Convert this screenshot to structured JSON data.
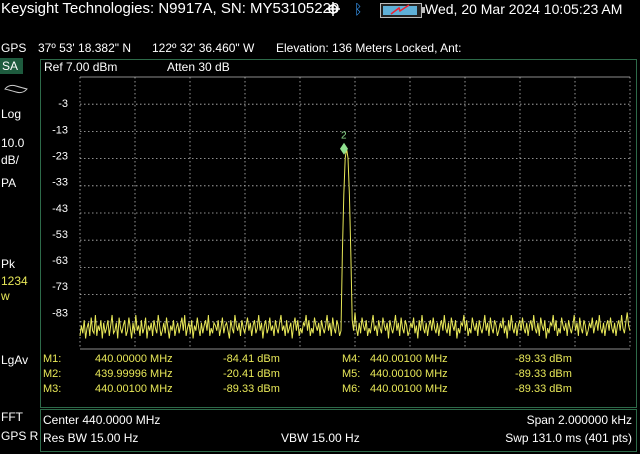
{
  "header": {
    "title": "Keysight Technologies: N9917A, SN: MY53105220",
    "datetime": "Wed, 20 Mar 2024 10:05:23 AM",
    "icons": [
      "gps-crosshair-icon",
      "bluetooth-icon",
      "battery-icon"
    ]
  },
  "gps": {
    "label": "GPS",
    "latitude": "37º 53' 18.382\" N",
    "longitude": "122º 32' 36.460\" W",
    "status": "Elevation: 136 Meters  Locked, Ant:"
  },
  "left_panel": {
    "mode": "SA",
    "scale_type": "Log",
    "scale_value": "10.0",
    "scale_unit": "dB/",
    "detector": "PA",
    "trace_label": "Pk",
    "trace_numbers": "1234",
    "trace_mode": "w",
    "average": "LgAv",
    "fft": "FFT",
    "gps_r": "GPS R"
  },
  "graph_header": {
    "ref_level": "Ref 7.00 dBm",
    "attenuation": "Atten 30 dB"
  },
  "chart_data": {
    "type": "line",
    "ylim": [
      -97,
      7
    ],
    "y_ticks": [
      "-3",
      "-13",
      "-23",
      "-33",
      "-43",
      "-53",
      "-63",
      "-73",
      "-83"
    ],
    "xlim_mhz": [
      439.999,
      440.001
    ],
    "colors": {
      "trace": "#e8e858",
      "grid": "#bdbdbd",
      "marker": "#8fe08f"
    },
    "peak_marker": {
      "label": "2",
      "x_mhz": 439.99996,
      "y_dbm": -20.41
    },
    "series": [
      {
        "values": [
          -92,
          -88,
          -91,
          -86,
          -93,
          -89,
          -87,
          -92,
          -85,
          -90,
          -91,
          -84,
          -92,
          -88,
          -90,
          -86,
          -93,
          -87,
          -91,
          -89,
          -86,
          -92,
          -88,
          -84,
          -91,
          -90,
          -87,
          -93,
          -85,
          -89,
          -91,
          -88,
          -86,
          -92,
          -90,
          -85,
          -89,
          -93,
          -87,
          -91,
          -84,
          -90,
          -88,
          -92,
          -86,
          -91,
          -89,
          -85,
          -93,
          -88,
          -90,
          -87,
          -92,
          -86,
          -89,
          -91,
          -84,
          -88,
          -92,
          -90,
          -87,
          -91,
          -85,
          -89,
          -93,
          -88,
          -90,
          -86,
          -92,
          -89,
          -87,
          -91,
          -88,
          -85,
          -90,
          -84,
          -92,
          -89,
          -87,
          -91,
          -86,
          -93,
          -88,
          -90,
          -85,
          -89,
          -92,
          -87,
          -91,
          -88,
          -86,
          -90,
          -84,
          -92,
          -89,
          -91,
          -87,
          -88,
          -90,
          -86,
          -92,
          -89,
          -85,
          -91,
          -88,
          -87,
          -90,
          -93,
          -86,
          -89,
          -91,
          -84,
          -88,
          -90,
          -87,
          -92,
          -86,
          -89,
          -91,
          -88,
          -85,
          -90,
          -87,
          -92,
          -88,
          -86,
          -91,
          -89,
          -84,
          -90,
          -87,
          -93,
          -88,
          -86,
          -91,
          -89,
          -85,
          -90,
          -88,
          -92,
          -86,
          -89,
          -91,
          -87,
          -84,
          -90,
          -88,
          -92,
          -86,
          -91,
          -89,
          -87,
          -93,
          -88,
          -85,
          -90,
          -86,
          -92,
          -89,
          -91,
          -87,
          -88,
          -84,
          -90,
          -86,
          -92,
          -89,
          -91,
          -85,
          -88,
          -90,
          -87,
          -92,
          -86,
          -89,
          -91,
          -88,
          -84,
          -90,
          -87,
          -92,
          -85,
          -89,
          -91,
          -86,
          -88,
          -92,
          -90,
          -60,
          -38,
          -24,
          -20.41,
          -24,
          -38,
          -60,
          -86,
          -90,
          -83,
          -89,
          -92,
          -87,
          -91,
          -85,
          -88,
          -90,
          -86,
          -92,
          -89,
          -91,
          -87,
          -84,
          -90,
          -88,
          -92,
          -86,
          -89,
          -91,
          -85,
          -88,
          -90,
          -87,
          -93,
          -86,
          -89,
          -91,
          -88,
          -84,
          -90,
          -87,
          -92,
          -85,
          -89,
          -91,
          -86,
          -88,
          -92,
          -90,
          -87,
          -89,
          -85,
          -91,
          -88,
          -93,
          -86,
          -90,
          -84,
          -89,
          -91,
          -87,
          -92,
          -88,
          -86,
          -90,
          -85,
          -89,
          -91,
          -87,
          -92,
          -88,
          -86,
          -90,
          -84,
          -89,
          -91,
          -87,
          -92,
          -85,
          -88,
          -90,
          -86,
          -93,
          -89,
          -91,
          -87,
          -88,
          -84,
          -90,
          -86,
          -92,
          -89,
          -91,
          -85,
          -88,
          -90,
          -87,
          -92,
          -86,
          -89,
          -91,
          -88,
          -84,
          -90,
          -87,
          -92,
          -85,
          -89,
          -91,
          -86,
          -88,
          -92,
          -90,
          -87,
          -89,
          -85,
          -91,
          -88,
          -93,
          -86,
          -90,
          -84,
          -89,
          -91,
          -87,
          -92,
          -88,
          -86,
          -90,
          -85,
          -89,
          -91,
          -87,
          -92,
          -88,
          -86,
          -90,
          -84,
          -89,
          -91,
          -87,
          -92,
          -85,
          -88,
          -90,
          -86,
          -93,
          -89,
          -91,
          -87,
          -88,
          -84,
          -90,
          -86,
          -92,
          -89,
          -91,
          -85,
          -88,
          -90,
          -87,
          -92,
          -86,
          -89,
          -91,
          -88,
          -84,
          -90,
          -87,
          -92,
          -85,
          -89,
          -91,
          -86,
          -88,
          -92,
          -90,
          -87,
          -89,
          -85,
          -91,
          -88,
          -86,
          -90,
          -84,
          -89,
          -91,
          -87,
          -92,
          -88,
          -86,
          -90,
          -85,
          -89,
          -91,
          -87,
          -92,
          -88,
          -86,
          -90,
          -84,
          -89,
          -91,
          -87,
          -83,
          -88,
          -90
        ]
      }
    ]
  },
  "markers": [
    {
      "name": "M1:",
      "freq": "440.00000 MHz",
      "level": "-84.41 dBm"
    },
    {
      "name": "M2:",
      "freq": "439.99996 MHz",
      "level": "-20.41 dBm"
    },
    {
      "name": "M3:",
      "freq": "440.00100 MHz",
      "level": "-89.33 dBm"
    },
    {
      "name": "M4:",
      "freq": "440.00100 MHz",
      "level": "-89.33 dBm"
    },
    {
      "name": "M5:",
      "freq": "440.00100 MHz",
      "level": "-89.33 dBm"
    },
    {
      "name": "M6:",
      "freq": "440.00100 MHz",
      "level": "-89.33 dBm"
    }
  ],
  "footer": {
    "center": "Center 440.0000 MHz",
    "span": "Span 2.000000 kHz",
    "res_bw": "Res BW 15.00  Hz",
    "vbw": "VBW 15.00  Hz",
    "sweep": "Swp 131.0 ms (401 pts)"
  }
}
